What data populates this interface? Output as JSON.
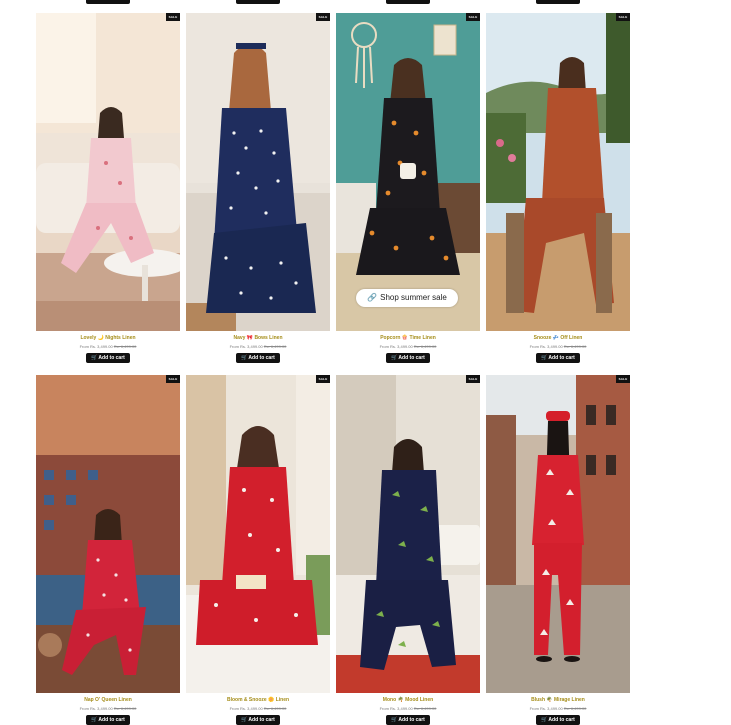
{
  "promo": {
    "label": "Shop summer sale",
    "icon": "link-icon"
  },
  "badge_text": "SALE",
  "cart_icon": "cart-icon",
  "products": [
    {
      "title": "Lovely 🌙 Nights Linen",
      "price_from": "From Rs. 3,499.00",
      "price_old": "Rs. 6,499.00",
      "cart_label": "Add to cart"
    },
    {
      "title": "Navy 🎀 Bows Linen",
      "price_from": "From Rs. 3,499.00",
      "price_old": "Rs. 6,499.00",
      "cart_label": "Add to cart"
    },
    {
      "title": "Popcorn 🍿 Time Linen",
      "price_from": "From Rs. 3,499.00",
      "price_old": "Rs. 6,499.00",
      "cart_label": "Add to cart"
    },
    {
      "title": "Snooze 💤 Off Linen",
      "price_from": "From Rs. 3,499.00",
      "price_old": "Rs. 6,499.00",
      "cart_label": "Add to cart"
    },
    {
      "title": "Nap O' Queen Linen",
      "price_from": "From Rs. 3,499.00",
      "price_old": "Rs. 6,499.00",
      "cart_label": "Add to cart"
    },
    {
      "title": "Bloom & Snooze 🌼 Linen",
      "price_from": "From Rs. 3,499.00",
      "price_old": "Rs. 6,499.00",
      "cart_label": "Add to cart"
    },
    {
      "title": "Mono 🌴 Mood Linen",
      "price_from": "From Rs. 3,499.00",
      "price_old": "Rs. 6,499.00",
      "cart_label": "Add to cart"
    },
    {
      "title": "Blush 🌴 Mirage Linen",
      "price_from": "From Rs. 3,499.00",
      "price_old": "Rs. 6,499.00",
      "cart_label": "Add to cart"
    }
  ],
  "colors": {
    "title": "#a58d19",
    "price": "#8b8b8b",
    "button": "#111111"
  }
}
